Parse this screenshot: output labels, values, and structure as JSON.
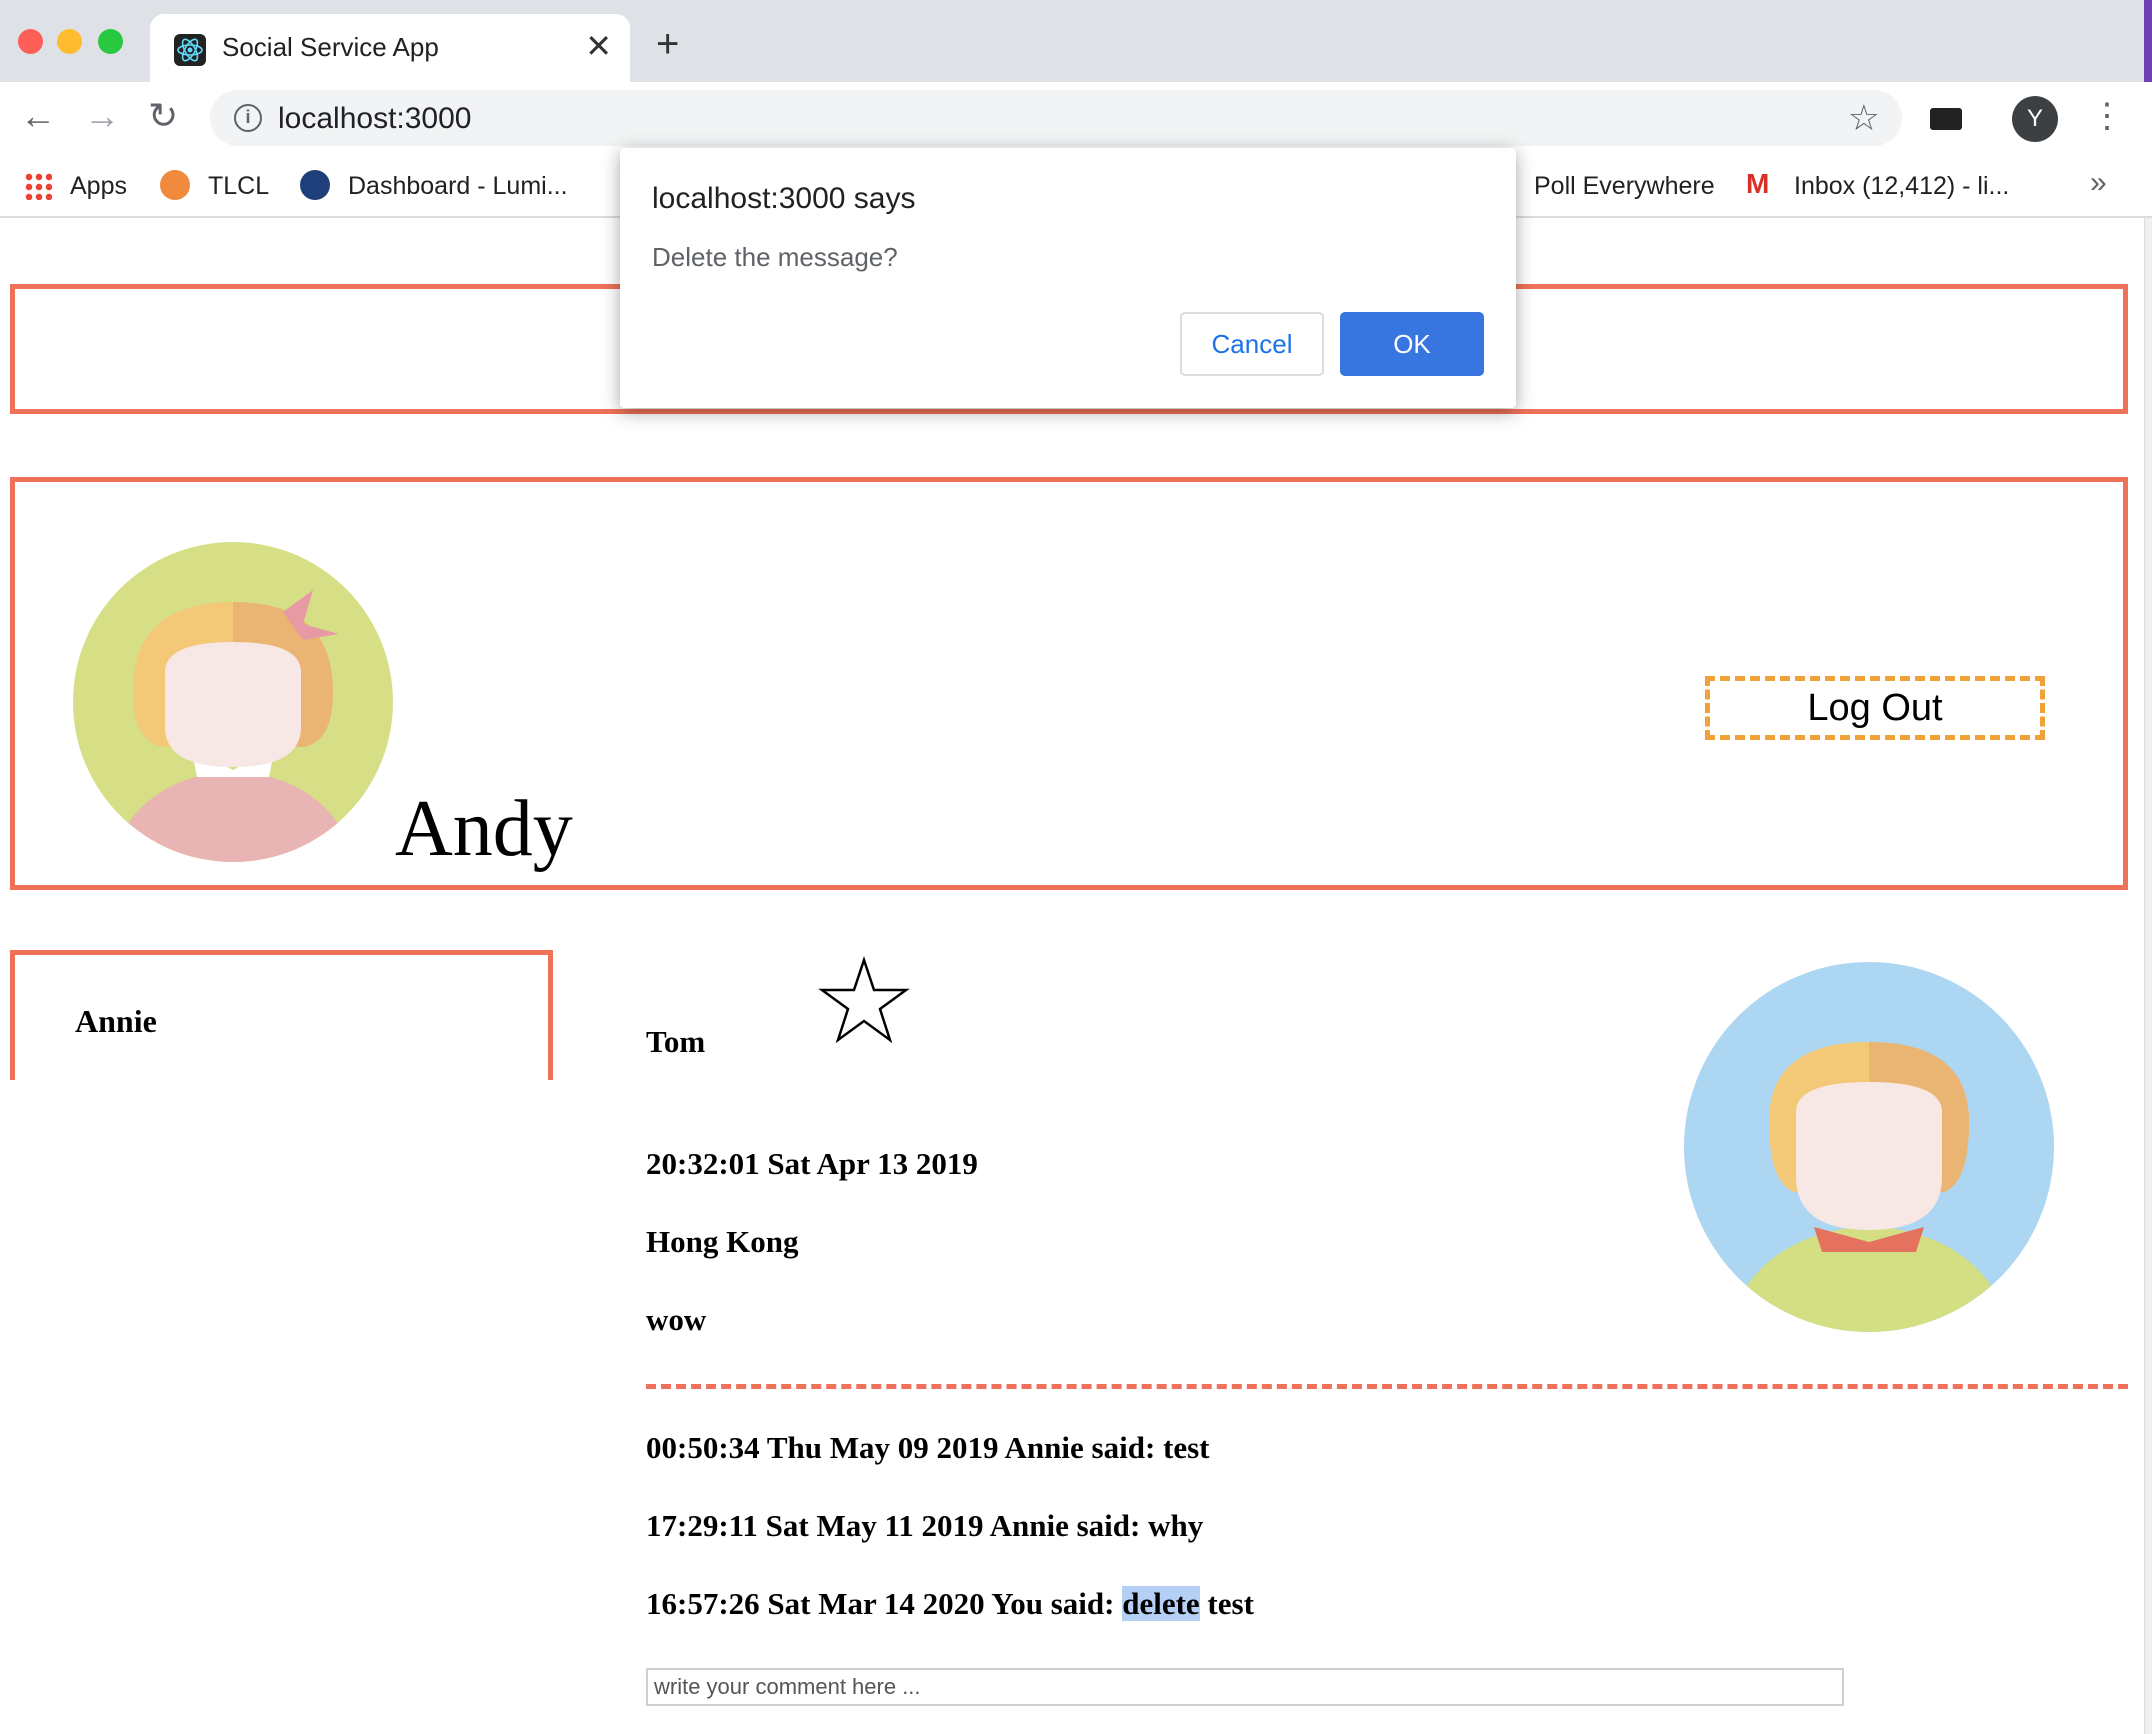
{
  "browser": {
    "tab_title": "Social Service App",
    "url": "localhost:3000",
    "profile_initial": "Y",
    "bookmarks": [
      {
        "label": "Apps"
      },
      {
        "label": "TLCL"
      },
      {
        "label": "Dashboard - Lumi..."
      },
      {
        "label": "Poll Everywhere"
      },
      {
        "label": "Inbox (12,412) - li..."
      }
    ],
    "more_bookmarks": "»"
  },
  "dialog": {
    "title": "localhost:3000 says",
    "message": "Delete the message?",
    "cancel_label": "Cancel",
    "ok_label": "OK"
  },
  "user": {
    "name": "Andy",
    "logout_label": "Log Out"
  },
  "contacts": [
    {
      "name": "Annie"
    }
  ],
  "post": {
    "author": "Tom",
    "time": "20:32:01 Sat Apr 13 2019",
    "location": "Hong Kong",
    "content": "wow",
    "comments": [
      {
        "text": "00:50:34 Thu May 09 2019 Annie said: test"
      },
      {
        "text": "17:29:11 Sat May 11 2019 Annie said: why"
      },
      {
        "prefix": "16:57:26 Sat Mar 14 2020 You said: ",
        "highlight": "delete",
        "suffix": " test"
      }
    ],
    "comment_placeholder": "write your comment here ..."
  },
  "colors": {
    "accent_border": "#ef7159",
    "logout_border": "#f1a236",
    "ok_button": "#3776e0"
  }
}
